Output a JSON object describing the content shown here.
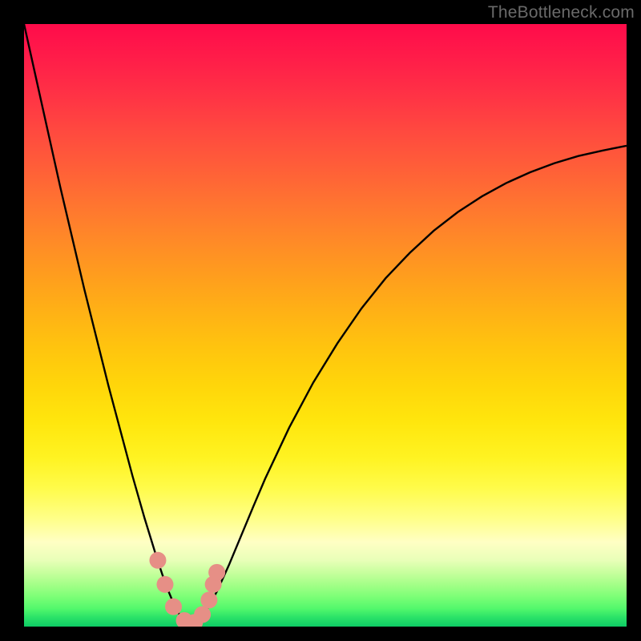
{
  "watermark": "TheBottleneck.com",
  "colors": {
    "curve_stroke": "#000000",
    "marker_fill": "#e68f86",
    "gradient_top": "#ff0b4a",
    "gradient_bottom": "#0ecb65"
  },
  "chart_data": {
    "type": "line",
    "title": "",
    "xlabel": "",
    "ylabel": "",
    "xlim": [
      0,
      100
    ],
    "ylim": [
      0,
      100
    ],
    "x": [
      0,
      2,
      4,
      6,
      8,
      10,
      12,
      14,
      16,
      18,
      20,
      22,
      23,
      24,
      25,
      26,
      27,
      28,
      29,
      30,
      32,
      34,
      36,
      38,
      40,
      44,
      48,
      52,
      56,
      60,
      64,
      68,
      72,
      76,
      80,
      84,
      88,
      92,
      96,
      100
    ],
    "values": [
      100,
      91,
      82,
      73,
      64.5,
      56,
      48,
      40,
      32.5,
      25,
      18,
      11.5,
      8.5,
      5.8,
      3.4,
      1.6,
      0.6,
      0.4,
      1.0,
      2.2,
      5.8,
      10.2,
      15,
      19.8,
      24.5,
      33,
      40.5,
      47,
      52.8,
      57.8,
      62,
      65.7,
      68.8,
      71.4,
      73.6,
      75.4,
      76.9,
      78.1,
      79.0,
      79.8
    ],
    "markers": [
      {
        "x": 22.2,
        "y": 11.0
      },
      {
        "x": 23.4,
        "y": 7.0
      },
      {
        "x": 24.8,
        "y": 3.3
      },
      {
        "x": 26.6,
        "y": 1.0
      },
      {
        "x": 28.3,
        "y": 0.7
      },
      {
        "x": 29.6,
        "y": 2.0
      },
      {
        "x": 30.7,
        "y": 4.4
      },
      {
        "x": 31.4,
        "y": 7.0
      },
      {
        "x": 32.0,
        "y": 9.0
      }
    ],
    "note": "x and values are in the 0–100 domain; y-axis is inverted visually (0 at bottom, 100 at top); values are estimated from the image since no axis ticks are shown."
  }
}
